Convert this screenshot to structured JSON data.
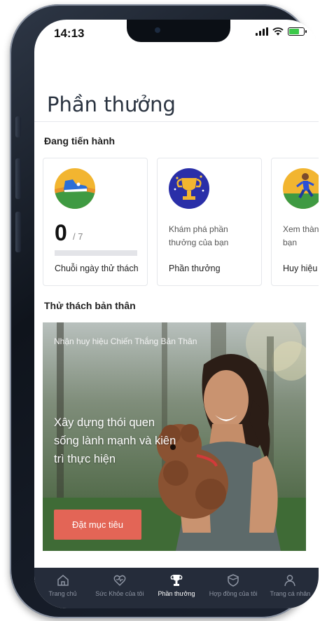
{
  "status_bar": {
    "time": "14:13"
  },
  "page": {
    "title": "Phần thưởng"
  },
  "in_progress": {
    "heading": "Đang tiến hành",
    "cards": [
      {
        "icon": "sneaker-icon",
        "count": "0",
        "total": "/ 7",
        "progress": 0.0,
        "footer": "Chuỗi ngày thử thách"
      },
      {
        "icon": "trophy-icon",
        "description": "Khám phá phần thưởng của bạn",
        "footer": "Phần thưởng"
      },
      {
        "icon": "runner-icon",
        "description": "Xem thành tích của bạn",
        "footer": "Huy hiệu"
      }
    ]
  },
  "self_challenge": {
    "heading": "Thử thách bản thân",
    "badge_text": "Nhận huy hiệu Chiến Thắng Bản Thân",
    "headline": "Xây dựng thói quen sống lành mạnh và kiên trì thực hiện",
    "cta_label": "Đặt mục tiêu"
  },
  "tab_bar": {
    "tabs": [
      {
        "label": "Trang chủ",
        "icon": "home-icon",
        "active": false
      },
      {
        "label": "Sức Khỏe của tôi",
        "icon": "heart-pulse-icon",
        "active": false
      },
      {
        "label": "Phần thưởng",
        "icon": "trophy-icon",
        "active": true
      },
      {
        "label": "Hợp đồng của tôi",
        "icon": "shield-icon",
        "active": false
      },
      {
        "label": "Trang cá nhân",
        "icon": "person-icon",
        "active": false
      }
    ]
  },
  "colors": {
    "accent": "#e36556",
    "tab_bar_bg": "#252c3a",
    "title_text": "#2a3340"
  }
}
